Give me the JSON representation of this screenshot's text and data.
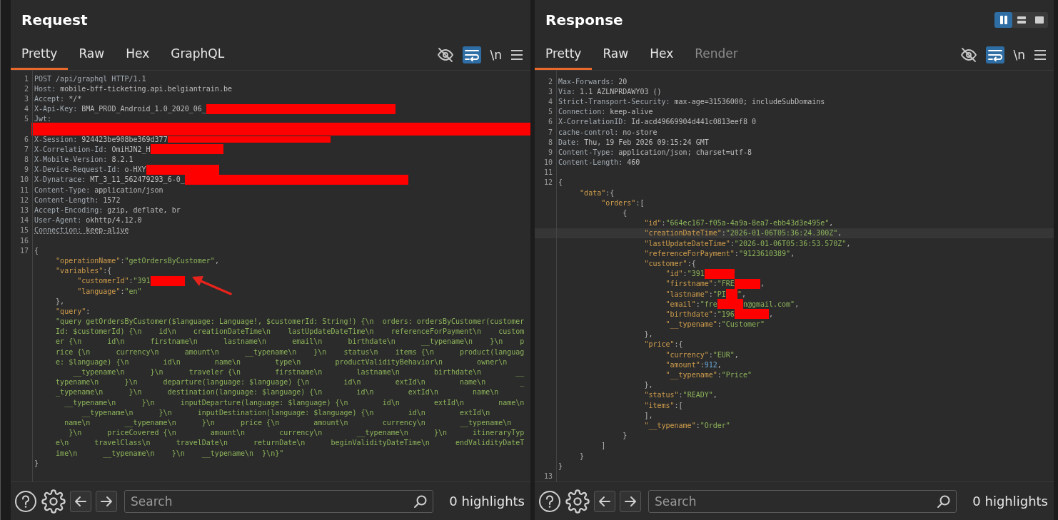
{
  "layout_buttons": [
    {
      "selected": true
    },
    {
      "selected": false
    },
    {
      "selected": false
    }
  ],
  "panels": [
    {
      "title": "Request",
      "tabs": [
        {
          "label": "Pretty",
          "selected": true,
          "disabled": false
        },
        {
          "label": "Raw",
          "selected": false,
          "disabled": false
        },
        {
          "label": "Hex",
          "selected": false,
          "disabled": false
        },
        {
          "label": "GraphQL",
          "selected": false,
          "disabled": false
        }
      ],
      "wrap_on": true,
      "newline_label": "\\n",
      "lines": [
        {
          "num": "1",
          "tokens": [
            {
              "kind": "hname",
              "text": "POST /api/graphql HTTP/1.1"
            }
          ]
        },
        {
          "num": "2",
          "tokens": [
            {
              "kind": "hname",
              "text": "Host:"
            },
            {
              "kind": "hval",
              "text": " mobile-bff-ticketing.api.belgiantrain.be"
            }
          ]
        },
        {
          "num": "3",
          "tokens": [
            {
              "kind": "hname",
              "text": "Accept:"
            },
            {
              "kind": "hval",
              "text": " */*"
            }
          ]
        },
        {
          "num": "4",
          "tokens": [
            {
              "kind": "hname",
              "text": "X-Api-Key:"
            },
            {
              "kind": "hval",
              "text": " BMA_PROD_Android_1.0_2020_06_"
            },
            {
              "kind": "redaction"
            }
          ]
        },
        {
          "num": "5",
          "tokens": [
            {
              "kind": "hname",
              "text": "Jwt:"
            }
          ]
        },
        {
          "tokens": [
            {
              "kind": "redaction"
            }
          ]
        },
        {
          "num": "6",
          "tokens": [
            {
              "kind": "hname",
              "text": "X-Session:"
            },
            {
              "kind": "hval",
              "text": " 924423be908be369d377"
            },
            {
              "kind": "redaction"
            }
          ]
        },
        {
          "num": "7",
          "tokens": [
            {
              "kind": "hname",
              "text": "X-Correlation-Id:"
            },
            {
              "kind": "hval",
              "text": " OmiHJN2_H"
            },
            {
              "kind": "redaction"
            }
          ]
        },
        {
          "num": "8",
          "tokens": [
            {
              "kind": "hname",
              "text": "X-Mobile-Version:"
            },
            {
              "kind": "hval",
              "text": " 8.2.1"
            }
          ]
        },
        {
          "num": "9",
          "tokens": [
            {
              "kind": "hname",
              "text": "X-Device-Request-Id:"
            },
            {
              "kind": "hval",
              "text": " o-HXY"
            },
            {
              "kind": "redaction"
            }
          ]
        },
        {
          "num": "10",
          "tokens": [
            {
              "kind": "hname",
              "text": "X-Dynatrace:"
            },
            {
              "kind": "hval",
              "text": " MT_3_11_562479293_6-0_"
            },
            {
              "kind": "redaction"
            }
          ]
        },
        {
          "num": "11",
          "tokens": [
            {
              "kind": "hname",
              "text": "Content-Type:"
            },
            {
              "kind": "hval",
              "text": " application/json"
            }
          ]
        },
        {
          "num": "12",
          "tokens": [
            {
              "kind": "hname",
              "text": "Content-Length:"
            },
            {
              "kind": "hval",
              "text": " 1572"
            }
          ]
        },
        {
          "num": "13",
          "tokens": [
            {
              "kind": "hname",
              "text": "Accept-Encoding:"
            },
            {
              "kind": "hval",
              "text": " gzip, deflate, br"
            }
          ]
        },
        {
          "num": "14",
          "tokens": [
            {
              "kind": "hname",
              "text": "User-Agent:"
            },
            {
              "kind": "hval",
              "text": " okhttp/4.12.0"
            }
          ]
        },
        {
          "num": "15",
          "underline": true,
          "tokens": [
            {
              "kind": "hname",
              "text": "Connection:"
            },
            {
              "kind": "hval",
              "text": " keep-alive"
            }
          ]
        },
        {
          "num": "16"
        },
        {
          "num": "17",
          "tokens": [
            {
              "kind": "punct",
              "text": "{"
            }
          ]
        },
        {
          "tokens": [
            {
              "kind": "key",
              "text": "     \"operationName\""
            },
            {
              "kind": "punct",
              "text": ":"
            },
            {
              "kind": "str",
              "text": "\"getOrdersByCustomer\""
            },
            {
              "kind": "punct",
              "text": ","
            }
          ]
        },
        {
          "tokens": [
            {
              "kind": "key",
              "text": "     \"variables\""
            },
            {
              "kind": "punct",
              "text": ":{"
            }
          ]
        },
        {
          "tokens": [
            {
              "kind": "key",
              "text": "          \"customerId\""
            },
            {
              "kind": "punct",
              "text": ":"
            },
            {
              "kind": "str",
              "text": "\"391"
            },
            {
              "kind": "redaction"
            },
            {
              "kind": "arrow"
            }
          ]
        },
        {
          "tokens": [
            {
              "kind": "key",
              "text": "          \"language\""
            },
            {
              "kind": "punct",
              "text": ":"
            },
            {
              "kind": "str",
              "text": "\"en\""
            }
          ]
        },
        {
          "tokens": [
            {
              "kind": "punct",
              "text": "     },"
            }
          ]
        },
        {
          "tokens": [
            {
              "kind": "key",
              "text": "     \"query\""
            },
            {
              "kind": "punct",
              "text": ":"
            }
          ]
        },
        {
          "tokens": [
            {
              "kind": "str",
              "text": "     \"query getOrdersByCustomer($language: Language!, $customerId: String!) {\\n  orders: ordersByCustomer(customer"
            }
          ]
        },
        {
          "tokens": [
            {
              "kind": "str",
              "text": "     Id: $customerId) {\\n    id\\n    creationDateTime\\n    lastUpdateDateTime\\n    referenceForPayment\\n    custom"
            }
          ]
        },
        {
          "tokens": [
            {
              "kind": "str",
              "text": "     er {\\n      id\\n      firstname\\n      lastname\\n      email\\n      birthdate\\n      __typename\\n    }\\n    p"
            }
          ]
        },
        {
          "tokens": [
            {
              "kind": "str",
              "text": "     rice {\\n      currency\\n      amount\\n      __typename\\n    }\\n    status\\n    items {\\n      product(languag"
            }
          ]
        },
        {
          "tokens": [
            {
              "kind": "str",
              "text": "     e: $language) {\\n        id\\n        name\\n        type\\n        productValidityBehavior\\n        owner\\n"
            }
          ]
        },
        {
          "tokens": [
            {
              "kind": "str",
              "text": "         __typename\\n      }\\n      traveler {\\n        firstname\\n        lastname\\n        birthdate\\n        __"
            }
          ]
        },
        {
          "tokens": [
            {
              "kind": "str",
              "text": "     typename\\n      }\\n      departure(language: $language) {\\n        id\\n        extId\\n        name\\n        _"
            }
          ]
        },
        {
          "tokens": [
            {
              "kind": "str",
              "text": "     _typename\\n      }\\n      destination(language: $language) {\\n        id\\n        extId\\n        name\\n"
            }
          ]
        },
        {
          "tokens": [
            {
              "kind": "str",
              "text": "       __typename\\n      }\\n      inputDeparture(language: $language) {\\n        id\\n        extId\\n        name\\n"
            }
          ]
        },
        {
          "tokens": [
            {
              "kind": "str",
              "text": "           __typename\\n      }\\n      inputDestination(language: $language) {\\n        id\\n        extId\\n"
            }
          ]
        },
        {
          "tokens": [
            {
              "kind": "str",
              "text": "       name\\n        __typename\\n      }\\n      price {\\n        amount\\n        currency\\n        __typename\\n"
            }
          ]
        },
        {
          "tokens": [
            {
              "kind": "str",
              "text": "        }\\n      priceCovered {\\n        amount\\n        currency\\n        __typename\\n      }\\n      itineraryTyp"
            }
          ]
        },
        {
          "tokens": [
            {
              "kind": "str",
              "text": "     e\\n      travelClass\\n      travelDate\\n      returnDate\\n      beginValidityDateTime\\n      endValidityDateT"
            }
          ]
        },
        {
          "tokens": [
            {
              "kind": "str",
              "text": "     ime\\n      __typename\\n    }\\n    __typename\\n  }\\n}\""
            }
          ]
        },
        {
          "tokens": [
            {
              "kind": "punct",
              "text": "}"
            }
          ]
        }
      ],
      "search": {
        "placeholder": "Search"
      },
      "highlights": "0 highlights"
    },
    {
      "title": "Response",
      "tabs": [
        {
          "label": "Pretty",
          "selected": true,
          "disabled": false
        },
        {
          "label": "Raw",
          "selected": false,
          "disabled": false
        },
        {
          "label": "Hex",
          "selected": false,
          "disabled": false
        },
        {
          "label": "Render",
          "selected": false,
          "disabled": true
        }
      ],
      "wrap_on": true,
      "newline_label": "\\n",
      "lines": [
        {
          "num": "2",
          "tokens": [
            {
              "kind": "hname",
              "text": "Max-Forwards:"
            },
            {
              "kind": "hval",
              "text": " 20"
            }
          ]
        },
        {
          "num": "3",
          "tokens": [
            {
              "kind": "hname",
              "text": "Via:"
            },
            {
              "kind": "hval",
              "text": " 1.1 AZLNPRDAWY03 ()"
            }
          ]
        },
        {
          "num": "4",
          "tokens": [
            {
              "kind": "hname",
              "text": "Strict-Transport-Security:"
            },
            {
              "kind": "hval",
              "text": " max-age=31536000; includeSubDomains"
            }
          ]
        },
        {
          "num": "5",
          "tokens": [
            {
              "kind": "hname",
              "text": "Connection:"
            },
            {
              "kind": "hval",
              "text": " keep-alive"
            }
          ]
        },
        {
          "num": "6",
          "tokens": [
            {
              "kind": "hname",
              "text": "X-CorrelationID:"
            },
            {
              "kind": "hval",
              "text": " Id-acd49669904d441c0813eef8 0"
            }
          ]
        },
        {
          "num": "7",
          "tokens": [
            {
              "kind": "hname",
              "text": "cache-control:"
            },
            {
              "kind": "hval",
              "text": " no-store"
            }
          ]
        },
        {
          "num": "8",
          "tokens": [
            {
              "kind": "hname",
              "text": "Date:"
            },
            {
              "kind": "hval",
              "text": " Thu, 19 Feb 2026 09:15:24 GMT"
            }
          ]
        },
        {
          "num": "9",
          "tokens": [
            {
              "kind": "hname",
              "text": "Content-Type:"
            },
            {
              "kind": "hval",
              "text": " application/json; charset=utf-8"
            }
          ]
        },
        {
          "num": "10",
          "tokens": [
            {
              "kind": "hname",
              "text": "Content-Length:"
            },
            {
              "kind": "hval",
              "text": " 460"
            }
          ]
        },
        {
          "num": "11"
        },
        {
          "num": "12",
          "tokens": [
            {
              "kind": "punct",
              "text": "{"
            }
          ]
        },
        {
          "tokens": [
            {
              "kind": "key",
              "text": "     \"data\""
            },
            {
              "kind": "punct",
              "text": ":{"
            }
          ]
        },
        {
          "tokens": [
            {
              "kind": "key",
              "text": "          \"orders\""
            },
            {
              "kind": "punct",
              "text": ":["
            }
          ]
        },
        {
          "tokens": [
            {
              "kind": "punct",
              "text": "               {"
            }
          ]
        },
        {
          "tokens": [
            {
              "kind": "key",
              "text": "                    \"id\""
            },
            {
              "kind": "punct",
              "text": ":"
            },
            {
              "kind": "str",
              "text": "\"664ec167-f05a-4a9a-8ea7-ebb43d3e495e\""
            },
            {
              "kind": "punct",
              "text": ","
            }
          ]
        },
        {
          "current": true,
          "tokens": [
            {
              "kind": "key",
              "text": "                    \"creationDateTime\""
            },
            {
              "kind": "punct",
              "text": ":"
            },
            {
              "kind": "str",
              "text": "\"2026-01-06T05:36:24.300Z\""
            },
            {
              "kind": "punct",
              "text": ","
            }
          ]
        },
        {
          "tokens": [
            {
              "kind": "key",
              "text": "                    \"lastUpdateDateTime\""
            },
            {
              "kind": "punct",
              "text": ":"
            },
            {
              "kind": "str",
              "text": "\"2026-01-06T05:36:53.570Z\""
            },
            {
              "kind": "punct",
              "text": ","
            }
          ]
        },
        {
          "tokens": [
            {
              "kind": "key",
              "text": "                    \"referenceForPayment\""
            },
            {
              "kind": "punct",
              "text": ":"
            },
            {
              "kind": "str",
              "text": "\"9123610389\""
            },
            {
              "kind": "punct",
              "text": ","
            }
          ]
        },
        {
          "tokens": [
            {
              "kind": "key",
              "text": "                    \"customer\""
            },
            {
              "kind": "punct",
              "text": ":{"
            }
          ]
        },
        {
          "tokens": [
            {
              "kind": "key",
              "text": "                         \"id\""
            },
            {
              "kind": "punct",
              "text": ":"
            },
            {
              "kind": "str",
              "text": "\"391"
            },
            {
              "kind": "redaction"
            }
          ]
        },
        {
          "tokens": [
            {
              "kind": "key",
              "text": "                         \"firstname\""
            },
            {
              "kind": "punct",
              "text": ":"
            },
            {
              "kind": "str",
              "text": "\"FRE"
            },
            {
              "kind": "redaction"
            },
            {
              "kind": "punct",
              "text": ","
            }
          ]
        },
        {
          "tokens": [
            {
              "kind": "key",
              "text": "                         \"lastname\""
            },
            {
              "kind": "punct",
              "text": ":"
            },
            {
              "kind": "str",
              "text": "\"PI"
            },
            {
              "kind": "redaction"
            },
            {
              "kind": "str",
              "text": "\""
            },
            {
              "kind": "punct",
              "text": ","
            }
          ]
        },
        {
          "tokens": [
            {
              "kind": "key",
              "text": "                         \"email\""
            },
            {
              "kind": "punct",
              "text": ":"
            },
            {
              "kind": "str",
              "text": "\"fre"
            },
            {
              "kind": "redaction"
            },
            {
              "kind": "str",
              "text": "n@gmail.com\""
            },
            {
              "kind": "punct",
              "text": ","
            }
          ]
        },
        {
          "tokens": [
            {
              "kind": "key",
              "text": "                         \"birthdate\""
            },
            {
              "kind": "punct",
              "text": ":"
            },
            {
              "kind": "str",
              "text": "\"196"
            },
            {
              "kind": "redaction"
            },
            {
              "kind": "punct",
              "text": ","
            }
          ]
        },
        {
          "tokens": [
            {
              "kind": "key",
              "text": "                         \"__typename\""
            },
            {
              "kind": "punct",
              "text": ":"
            },
            {
              "kind": "str",
              "text": "\"Customer\""
            }
          ]
        },
        {
          "tokens": [
            {
              "kind": "punct",
              "text": "                    },"
            }
          ]
        },
        {
          "tokens": [
            {
              "kind": "key",
              "text": "                    \"price\""
            },
            {
              "kind": "punct",
              "text": ":{"
            }
          ]
        },
        {
          "tokens": [
            {
              "kind": "key",
              "text": "                         \"currency\""
            },
            {
              "kind": "punct",
              "text": ":"
            },
            {
              "kind": "str",
              "text": "\"EUR\""
            },
            {
              "kind": "punct",
              "text": ","
            }
          ]
        },
        {
          "tokens": [
            {
              "kind": "key",
              "text": "                         \"amount\""
            },
            {
              "kind": "punct",
              "text": ":"
            },
            {
              "kind": "num",
              "text": "912"
            },
            {
              "kind": "punct",
              "text": ","
            }
          ]
        },
        {
          "tokens": [
            {
              "kind": "key",
              "text": "                         \"__typename\""
            },
            {
              "kind": "punct",
              "text": ":"
            },
            {
              "kind": "str",
              "text": "\"Price\""
            }
          ]
        },
        {
          "tokens": [
            {
              "kind": "punct",
              "text": "                    },"
            }
          ]
        },
        {
          "tokens": [
            {
              "kind": "key",
              "text": "                    \"status\""
            },
            {
              "kind": "punct",
              "text": ":"
            },
            {
              "kind": "str",
              "text": "\"READY\""
            },
            {
              "kind": "punct",
              "text": ","
            }
          ]
        },
        {
          "tokens": [
            {
              "kind": "key",
              "text": "                    \"items\""
            },
            {
              "kind": "punct",
              "text": ":["
            }
          ]
        },
        {
          "tokens": [
            {
              "kind": "punct",
              "text": "                    ],"
            }
          ]
        },
        {
          "tokens": [
            {
              "kind": "key",
              "text": "                    \"__typename\""
            },
            {
              "kind": "punct",
              "text": ":"
            },
            {
              "kind": "str",
              "text": "\"Order\""
            }
          ]
        },
        {
          "tokens": [
            {
              "kind": "punct",
              "text": "               }"
            }
          ]
        },
        {
          "tokens": [
            {
              "kind": "punct",
              "text": "          ]"
            }
          ]
        },
        {
          "tokens": [
            {
              "kind": "punct",
              "text": "     }"
            }
          ]
        },
        {
          "tokens": [
            {
              "kind": "punct",
              "text": "}"
            }
          ]
        },
        {
          "num": "13"
        }
      ],
      "search": {
        "placeholder": "Search"
      },
      "highlights": "0 highlights"
    }
  ]
}
